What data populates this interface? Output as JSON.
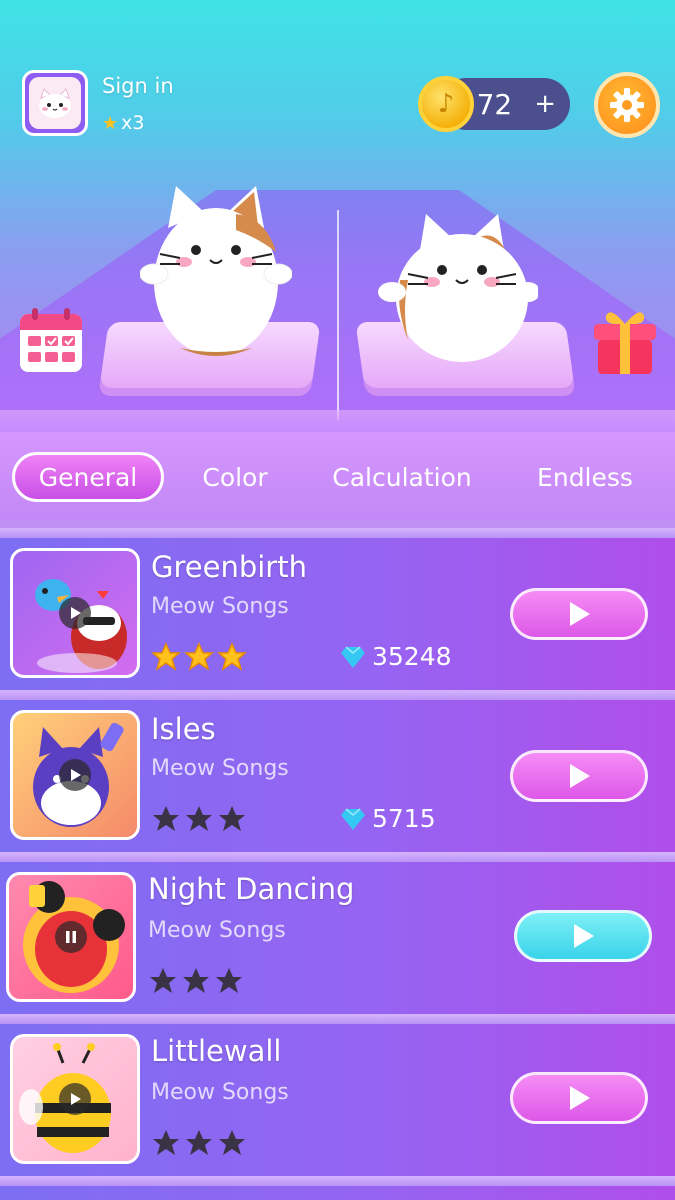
{
  "header": {
    "signin_label": "Sign in",
    "stars_label": "x3",
    "coins_value": "72",
    "coins_plus": "+",
    "coin_icon": "music-coin-icon",
    "settings_icon": "gear-icon"
  },
  "hero": {
    "calendar_icon": "calendar-icon",
    "gift_icon": "gift-icon"
  },
  "tabs": [
    {
      "label": "General",
      "active": true
    },
    {
      "label": "Color",
      "active": false
    },
    {
      "label": "Calculation",
      "active": false
    },
    {
      "label": "Endless",
      "active": false
    }
  ],
  "songs": [
    {
      "title": "Greenbirth",
      "artist": "Meow Songs",
      "stars_earned": 3,
      "stars_total": 3,
      "gems": "35248",
      "play_color": "pink"
    },
    {
      "title": "Isles",
      "artist": "Meow Songs",
      "stars_earned": 0,
      "stars_total": 3,
      "gems": "5715",
      "play_color": "pink"
    },
    {
      "title": "Night Dancing",
      "artist": "Meow Songs",
      "stars_earned": 0,
      "stars_total": 3,
      "gems": "",
      "play_color": "blue"
    },
    {
      "title": "Littlewall",
      "artist": "Meow Songs",
      "stars_earned": 0,
      "stars_total": 3,
      "gems": "",
      "play_color": "pink"
    }
  ],
  "colors": {
    "star_earned": "#ffc21c",
    "star_empty": "#3a3346",
    "gem": "#35c8f2",
    "play_pink": "#e66ef0",
    "play_blue": "#52dcef"
  }
}
